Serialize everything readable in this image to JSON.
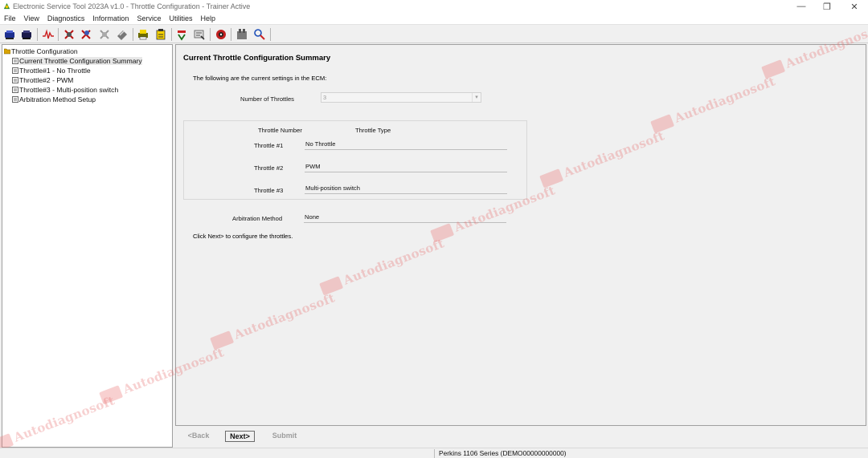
{
  "window": {
    "title": "Electronic Service Tool 2023A v1.0 - Throttle Configuration - Trainer Active",
    "controls": {
      "minimize": "—",
      "maximize": "❐",
      "close": "✕"
    }
  },
  "menu": [
    "File",
    "View",
    "Diagnostics",
    "Information",
    "Service",
    "Utilities",
    "Help"
  ],
  "toolbar_icons": [
    "connect-icon",
    "disconnect-icon",
    "graph-icon",
    "diagnostic-codes-icon",
    "event-codes-icon",
    "logged-events-icon",
    "clear-icon",
    "print-icon",
    "calibration-icon",
    "flash-icon",
    "report-icon",
    "ecm-summary-icon",
    "tools-icon",
    "help-search-icon"
  ],
  "tree": {
    "root": "Throttle Configuration",
    "items": [
      "Current Throttle Configuration Summary",
      "Throttle#1 - No Throttle",
      "Throttle#2 - PWM",
      "Throttle#3 - Multi-position switch",
      "Arbitration Method Setup"
    ]
  },
  "main": {
    "title": "Current Throttle Configuration Summary",
    "intro": "The following are the current settings in the ECM:",
    "num_throttles_label": "Number of Throttles",
    "num_throttles_value": "3",
    "header_number": "Throttle Number",
    "header_type": "Throttle Type",
    "throttles": [
      {
        "label": "Throttle #1",
        "value": "No Throttle"
      },
      {
        "label": "Throttle #2",
        "value": "PWM"
      },
      {
        "label": "Throttle #3",
        "value": "Multi-position switch"
      }
    ],
    "arbitration_label": "Arbitration Method",
    "arbitration_value": "None",
    "footer": "Click Next> to configure the throttles."
  },
  "buttons": {
    "back": "<Back",
    "next": "Next>",
    "submit": "Submit"
  },
  "status": {
    "ecm": "Perkins 1106 Series (DEMO00000000000)"
  },
  "watermark": "Autodiagnosoft"
}
